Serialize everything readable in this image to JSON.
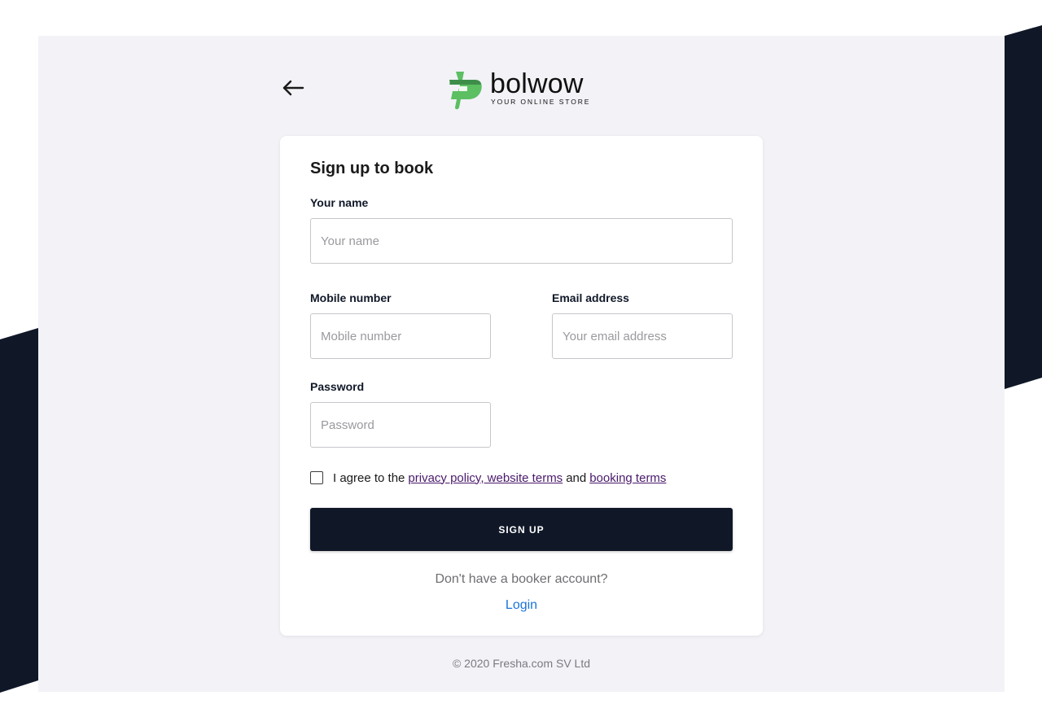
{
  "brand": {
    "name": "bolwow",
    "tagline": "YOUR ONLINE STORE",
    "mark_color_dark": "#3e8e4a",
    "mark_color_light": "#5cbf62"
  },
  "colors": {
    "panel_bg": "#f2f2f7",
    "dark_accent": "#101828",
    "link_purple": "#4a1a6b",
    "link_blue": "#1a73d9"
  },
  "header": {
    "back_icon": "arrow-left-icon"
  },
  "form": {
    "title": "Sign up to book",
    "name": {
      "label": "Your name",
      "placeholder": "Your name",
      "value": ""
    },
    "mobile": {
      "label": "Mobile number",
      "placeholder": "Mobile number",
      "value": ""
    },
    "email": {
      "label": "Email address",
      "placeholder": "Your email address",
      "value": ""
    },
    "password": {
      "label": "Password",
      "placeholder": "Password",
      "value": ""
    },
    "agree": {
      "checked": false,
      "prefix": "I agree to the",
      "link1": "privacy policy, website terms",
      "middle": "and",
      "link2": "booking terms"
    },
    "submit_label": "SIGN UP",
    "account_prompt": "Don't have a booker account?",
    "login_label": "Login"
  },
  "footer": {
    "copyright": "© 2020 Fresha.com SV Ltd"
  }
}
